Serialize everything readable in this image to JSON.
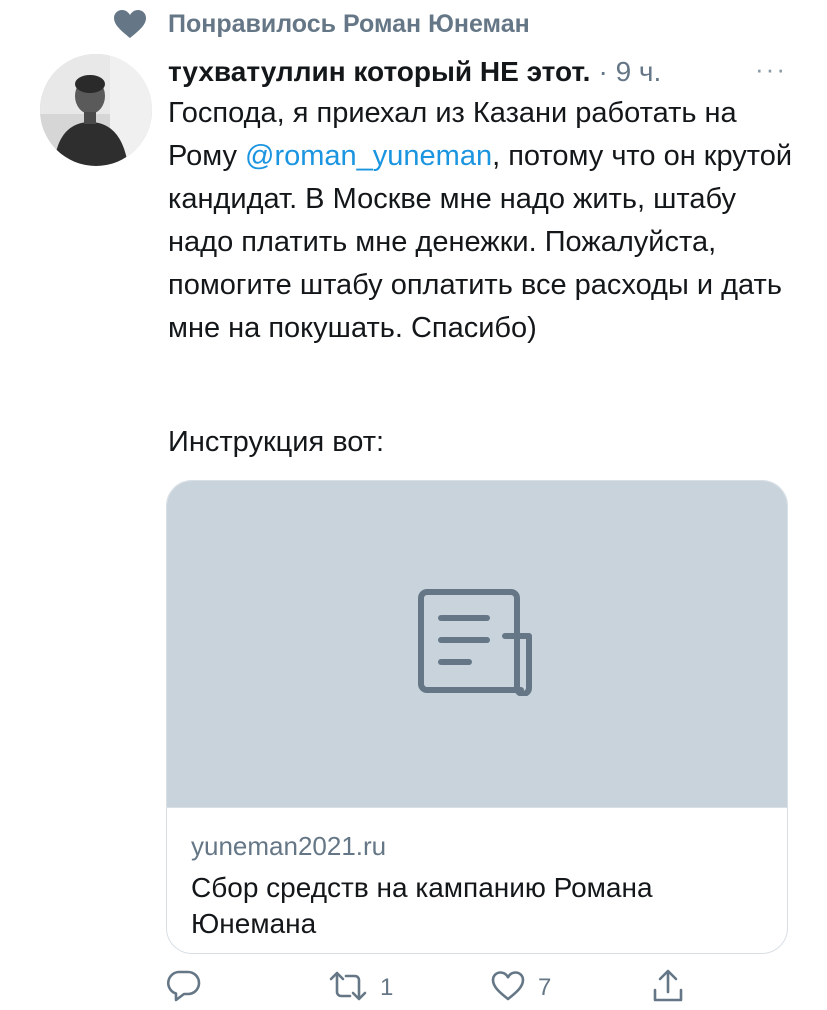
{
  "social_context": {
    "icon": "heart-icon",
    "text": "Понравилось Роман Юнеман"
  },
  "tweet": {
    "author_name": "тухватуллин который НЕ этот.",
    "time": "· 9 ч.",
    "more": "···",
    "body_part1": "Господа, я приехал из Казани работать на Рому ",
    "mention": "@roman_yuneman",
    "body_part2": ", потому что он крутой кандидат. В Москве мне надо жить, штабу надо платить мне денежки. Пожалуйста, помогите штабу оплатить все расходы и дать мне на покушать. Спасибо)",
    "instructions": "Инструкция вот:"
  },
  "card": {
    "icon": "document-icon",
    "domain": "yuneman2021.ru",
    "title": "Сбор средств на кампанию Романа Юнемана"
  },
  "actions": {
    "reply_icon": "reply-icon",
    "retweet_icon": "retweet-icon",
    "retweet_count": "1",
    "like_icon": "heart-outline-icon",
    "like_count": "7",
    "share_icon": "share-icon"
  },
  "colors": {
    "text": "#14171a",
    "secondary": "#657786",
    "link": "#1b95e0",
    "card_media_bg": "#c8d3dc",
    "border": "#d8dfe5"
  }
}
